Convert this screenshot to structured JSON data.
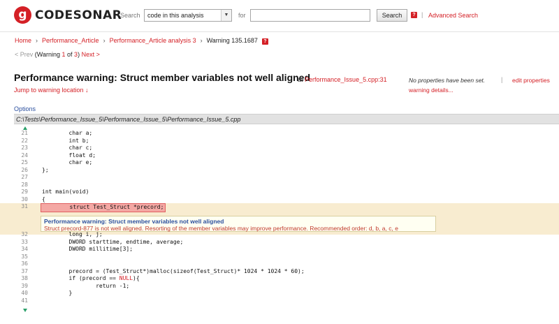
{
  "header": {
    "logo_mark": "g",
    "logo_text": "CODESONAR",
    "search_label": "Search",
    "scope_value": "code in this analysis",
    "for_label": "for",
    "query_value": "",
    "search_button": "Search",
    "help_glyph": "?",
    "separator": "|",
    "advanced_search": "Advanced Search"
  },
  "breadcrumb": {
    "items": [
      "Home",
      "Performance_Article",
      "Performance_Article analysis 3"
    ],
    "current": "Warning 135.1687",
    "separator": "›"
  },
  "pager": {
    "prev": "< Prev",
    "open": "(Warning",
    "current": "1",
    "of": "of",
    "total": "3",
    "close": ")",
    "next": "Next >"
  },
  "warning": {
    "title": "Performance warning: Struct member variables not well aligned",
    "at": "at",
    "location": "Performance_Issue_5.cpp:31",
    "jump": "Jump to warning location ↓",
    "no_properties": "No properties have been set.",
    "separator": "|",
    "edit_properties": "edit properties",
    "details": "warning details..."
  },
  "options": "Options",
  "file_path": "C:\\Tests\\Performance_Issue_5\\Performance_Issue_5\\Performance_Issue_5.cpp",
  "code_lines": [
    {
      "n": "21",
      "text": "        char a;"
    },
    {
      "n": "22",
      "text": "        int b;"
    },
    {
      "n": "23",
      "text": "        char c;"
    },
    {
      "n": "24",
      "text": "        float d;"
    },
    {
      "n": "25",
      "text": "        char e;"
    },
    {
      "n": "26",
      "text": "};"
    },
    {
      "n": "27",
      "text": ""
    },
    {
      "n": "28",
      "text": ""
    },
    {
      "n": "29",
      "text": "int main(void)"
    },
    {
      "n": "30",
      "text": "{"
    },
    {
      "n": "31",
      "text": "        struct Test_Struct *precord;"
    },
    {
      "n": "32",
      "text": "        long i, j;"
    },
    {
      "n": "33",
      "text": "        DWORD starttime, endtime, average;"
    },
    {
      "n": "34",
      "text": "        DWORD millitime[3];"
    },
    {
      "n": "35",
      "text": ""
    },
    {
      "n": "36",
      "text": ""
    },
    {
      "n": "37",
      "text": "        precord = (Test_Struct*)malloc(sizeof(Test_Struct)* 1024 * 1024 * 60);"
    },
    {
      "n": "38",
      "text_before": "        if (precord == ",
      "null": "NULL",
      "text_after": "){"
    },
    {
      "n": "39",
      "text": "                return -1;"
    },
    {
      "n": "40",
      "text": "        }"
    },
    {
      "n": "41",
      "text": ""
    }
  ],
  "popup": {
    "title": "Performance warning: Struct member variables not well aligned",
    "text": "Struct precord-877 is not well aligned. Resorting of the member variables may improve performance. Recommended order: d, b, a, c, e"
  },
  "colors": {
    "brand_red": "#d42026",
    "highlight_band": "#f8ecd0",
    "highlight_line": "#f4a8a4",
    "options_blue": "#2b4f9e"
  }
}
